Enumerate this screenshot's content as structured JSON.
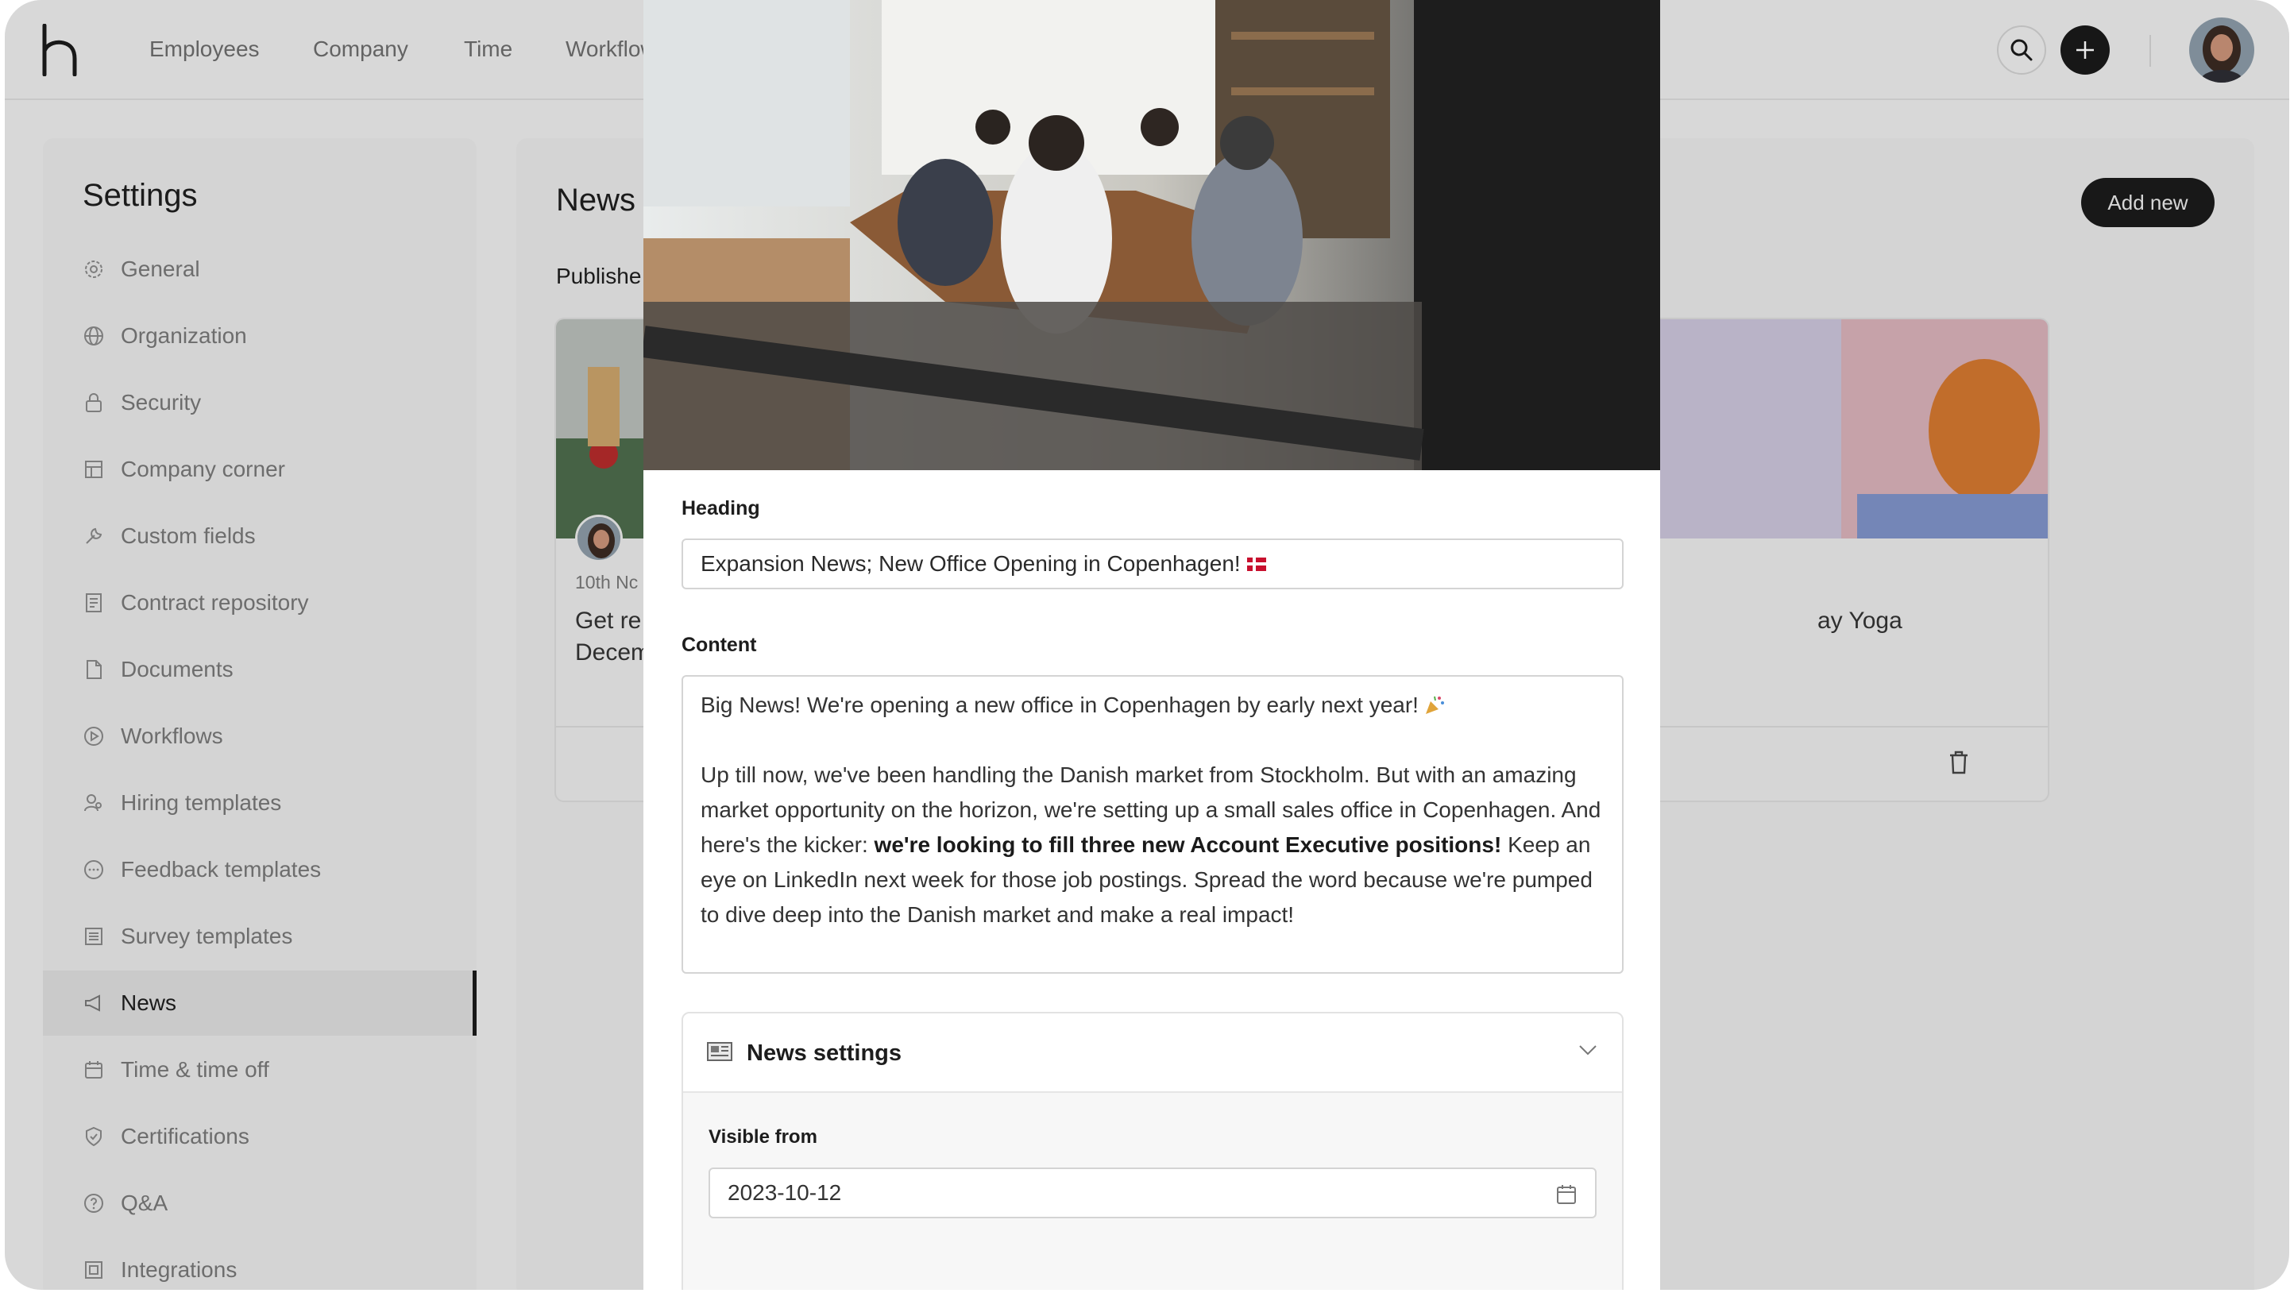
{
  "app": {
    "nav": {
      "items": [
        "Employees",
        "Company",
        "Time",
        "Workflows"
      ],
      "search_icon": "search-icon",
      "plus_icon": "plus-icon"
    }
  },
  "sidebar": {
    "title": "Settings",
    "items": [
      {
        "label": "General",
        "icon": "gear-icon"
      },
      {
        "label": "Organization",
        "icon": "globe-icon"
      },
      {
        "label": "Security",
        "icon": "lock-icon"
      },
      {
        "label": "Company corner",
        "icon": "building-icon"
      },
      {
        "label": "Custom fields",
        "icon": "wrench-icon"
      },
      {
        "label": "Contract repository",
        "icon": "contract-icon"
      },
      {
        "label": "Documents",
        "icon": "document-icon"
      },
      {
        "label": "Workflows",
        "icon": "play-circle-icon"
      },
      {
        "label": "Hiring templates",
        "icon": "person-search-icon"
      },
      {
        "label": "Feedback templates",
        "icon": "chat-icon"
      },
      {
        "label": "Survey templates",
        "icon": "list-icon"
      },
      {
        "label": "News",
        "icon": "megaphone-icon",
        "active": true
      },
      {
        "label": "Time & time off",
        "icon": "calendar-icon"
      },
      {
        "label": "Certifications",
        "icon": "shield-check-icon"
      },
      {
        "label": "Q&A",
        "icon": "question-icon"
      },
      {
        "label": "Integrations",
        "icon": "integrations-icon"
      }
    ]
  },
  "main": {
    "title": "News",
    "published_label": "Publishe",
    "add_new": "Add new",
    "cards": [
      {
        "date": "10th Nc",
        "title_line1": "Get re",
        "title_line2": "Decem"
      },
      {
        "title_line1": "ay Yoga"
      }
    ]
  },
  "modal": {
    "heading_label": "Heading",
    "heading_value": "Expansion News; New Office Opening in Copenhagen!",
    "content_label": "Content",
    "content": {
      "line1": "Big News! We're opening a new office in Copenhagen by early next year!",
      "para_a": "Up till now, we've been handling the Danish market from Stockholm. But with an amazing market opportunity on the horizon, we're setting up a small sales office in Copenhagen. And here's the kicker: ",
      "para_bold": "we're looking to fill three new Account Executive positions!",
      "para_b": " Keep an eye on LinkedIn next week for those job postings. Spread the word because we're pumped to dive deep into the Danish market and make a real impact!"
    },
    "settings": {
      "title": "News settings",
      "visible_from_label": "Visible from",
      "visible_from_value": "2023-10-12"
    }
  }
}
